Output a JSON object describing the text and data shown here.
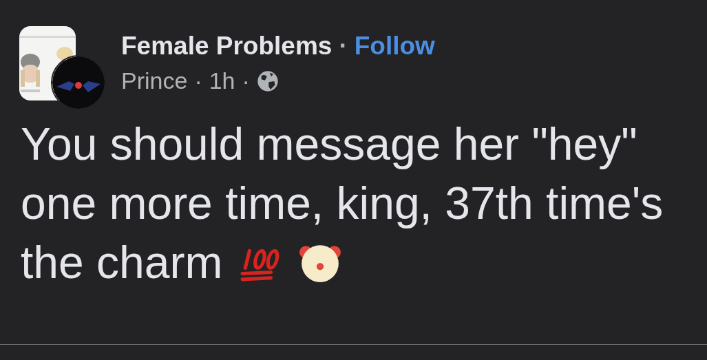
{
  "post": {
    "group": "Female Problems",
    "separator": "·",
    "follow": "Follow",
    "author": "Prince",
    "time": "1h",
    "text": "You should message her \"hey\" one more time, king, 37th time's the charm"
  }
}
